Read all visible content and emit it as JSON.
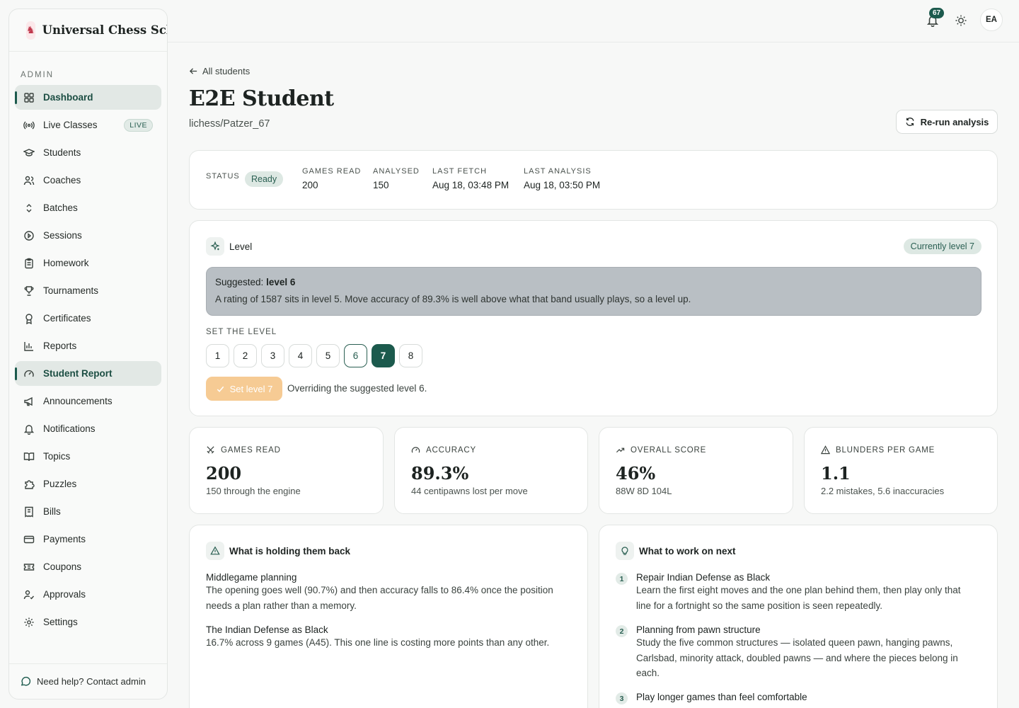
{
  "brand": {
    "name": "Universal Chess Sch"
  },
  "sidebar": {
    "section": "ADMIN",
    "items": [
      {
        "label": "Dashboard",
        "icon": "dashboard-icon"
      },
      {
        "label": "Live Classes",
        "icon": "broadcast-icon",
        "badge": "LIVE"
      },
      {
        "label": "Students",
        "icon": "graduation-cap-icon"
      },
      {
        "label": "Coaches",
        "icon": "users-icon"
      },
      {
        "label": "Batches",
        "icon": "chevrons-up-down-icon"
      },
      {
        "label": "Sessions",
        "icon": "play-circle-icon"
      },
      {
        "label": "Homework",
        "icon": "clipboard-icon"
      },
      {
        "label": "Tournaments",
        "icon": "trophy-icon"
      },
      {
        "label": "Certificates",
        "icon": "award-icon"
      },
      {
        "label": "Reports",
        "icon": "bar-chart-icon"
      },
      {
        "label": "Student Report",
        "icon": "gauge-icon"
      },
      {
        "label": "Announcements",
        "icon": "megaphone-icon"
      },
      {
        "label": "Notifications",
        "icon": "bell-icon"
      },
      {
        "label": "Topics",
        "icon": "book-open-icon"
      },
      {
        "label": "Puzzles",
        "icon": "puzzle-icon"
      },
      {
        "label": "Bills",
        "icon": "receipt-icon"
      },
      {
        "label": "Payments",
        "icon": "credit-card-icon"
      },
      {
        "label": "Coupons",
        "icon": "ticket-icon"
      },
      {
        "label": "Approvals",
        "icon": "user-check-icon"
      },
      {
        "label": "Settings",
        "icon": "gear-icon"
      }
    ],
    "help": "Need help? Contact admin"
  },
  "topbar": {
    "notification_count": "67",
    "avatar_initials": "EA"
  },
  "page": {
    "back_label": "All students",
    "title": "E2E Student",
    "handle": "lichess/Patzer_67",
    "rerun_label": "Re-run analysis"
  },
  "status": {
    "label": "STATUS",
    "value": "Ready",
    "games_read_label": "GAMES READ",
    "games_read": "200",
    "analysed_label": "ANALYSED",
    "analysed": "150",
    "last_fetch_label": "LAST FETCH",
    "last_fetch": "Aug 18, 03:48 PM",
    "last_analysis_label": "LAST ANALYSIS",
    "last_analysis": "Aug 18, 03:50 PM"
  },
  "level": {
    "title": "Level",
    "current": "Currently level 7",
    "suggested_prefix": "Suggested:",
    "suggested_value": "level 6",
    "suggestion_text": "A rating of 1587 sits in level 5. Move accuracy of 89.3% is well above what that band usually plays, so a level up.",
    "set_label": "SET THE LEVEL",
    "options": [
      "1",
      "2",
      "3",
      "4",
      "5",
      "6",
      "7",
      "8"
    ],
    "suggested_option": "6",
    "selected_option": "7",
    "set_button": "Set level 7",
    "override_note": "Overriding the suggested level 6."
  },
  "stats": [
    {
      "label": "GAMES READ",
      "icon": "swords-icon",
      "value": "200",
      "sub": "150 through the engine"
    },
    {
      "label": "ACCURACY",
      "icon": "gauge-icon",
      "value": "89.3%",
      "sub": "44 centipawns lost per move"
    },
    {
      "label": "OVERALL SCORE",
      "icon": "trending-up-icon",
      "value": "46%",
      "sub": "88W 8D 104L"
    },
    {
      "label": "BLUNDERS PER GAME",
      "icon": "warning-icon",
      "value": "1.1",
      "sub": "2.2 mistakes, 5.6 inaccuracies"
    }
  ],
  "holding_back": {
    "title": "What is holding them back",
    "items": [
      {
        "title": "Middlegame planning",
        "detail": "The opening goes well (90.7%) and then accuracy falls to 86.4% once the position needs a plan rather than a memory."
      },
      {
        "title": "The Indian Defense as Black",
        "detail": "16.7% across 9 games (A45). This one line is costing more points than any other."
      }
    ]
  },
  "work_next": {
    "title": "What to work on next",
    "items": [
      {
        "n": "1",
        "title": "Repair Indian Defense as Black",
        "detail": "Learn the first eight moves and the one plan behind them, then play only that line for a fortnight so the same position is seen repeatedly."
      },
      {
        "n": "2",
        "title": "Planning from pawn structure",
        "detail": "Study the five common structures — isolated queen pawn, hanging pawns, Carlsbad, minority attack, doubled pawns — and where the pieces belong in each."
      },
      {
        "n": "3",
        "title": "Play longer games than feel comfortable",
        "detail": ""
      }
    ]
  }
}
